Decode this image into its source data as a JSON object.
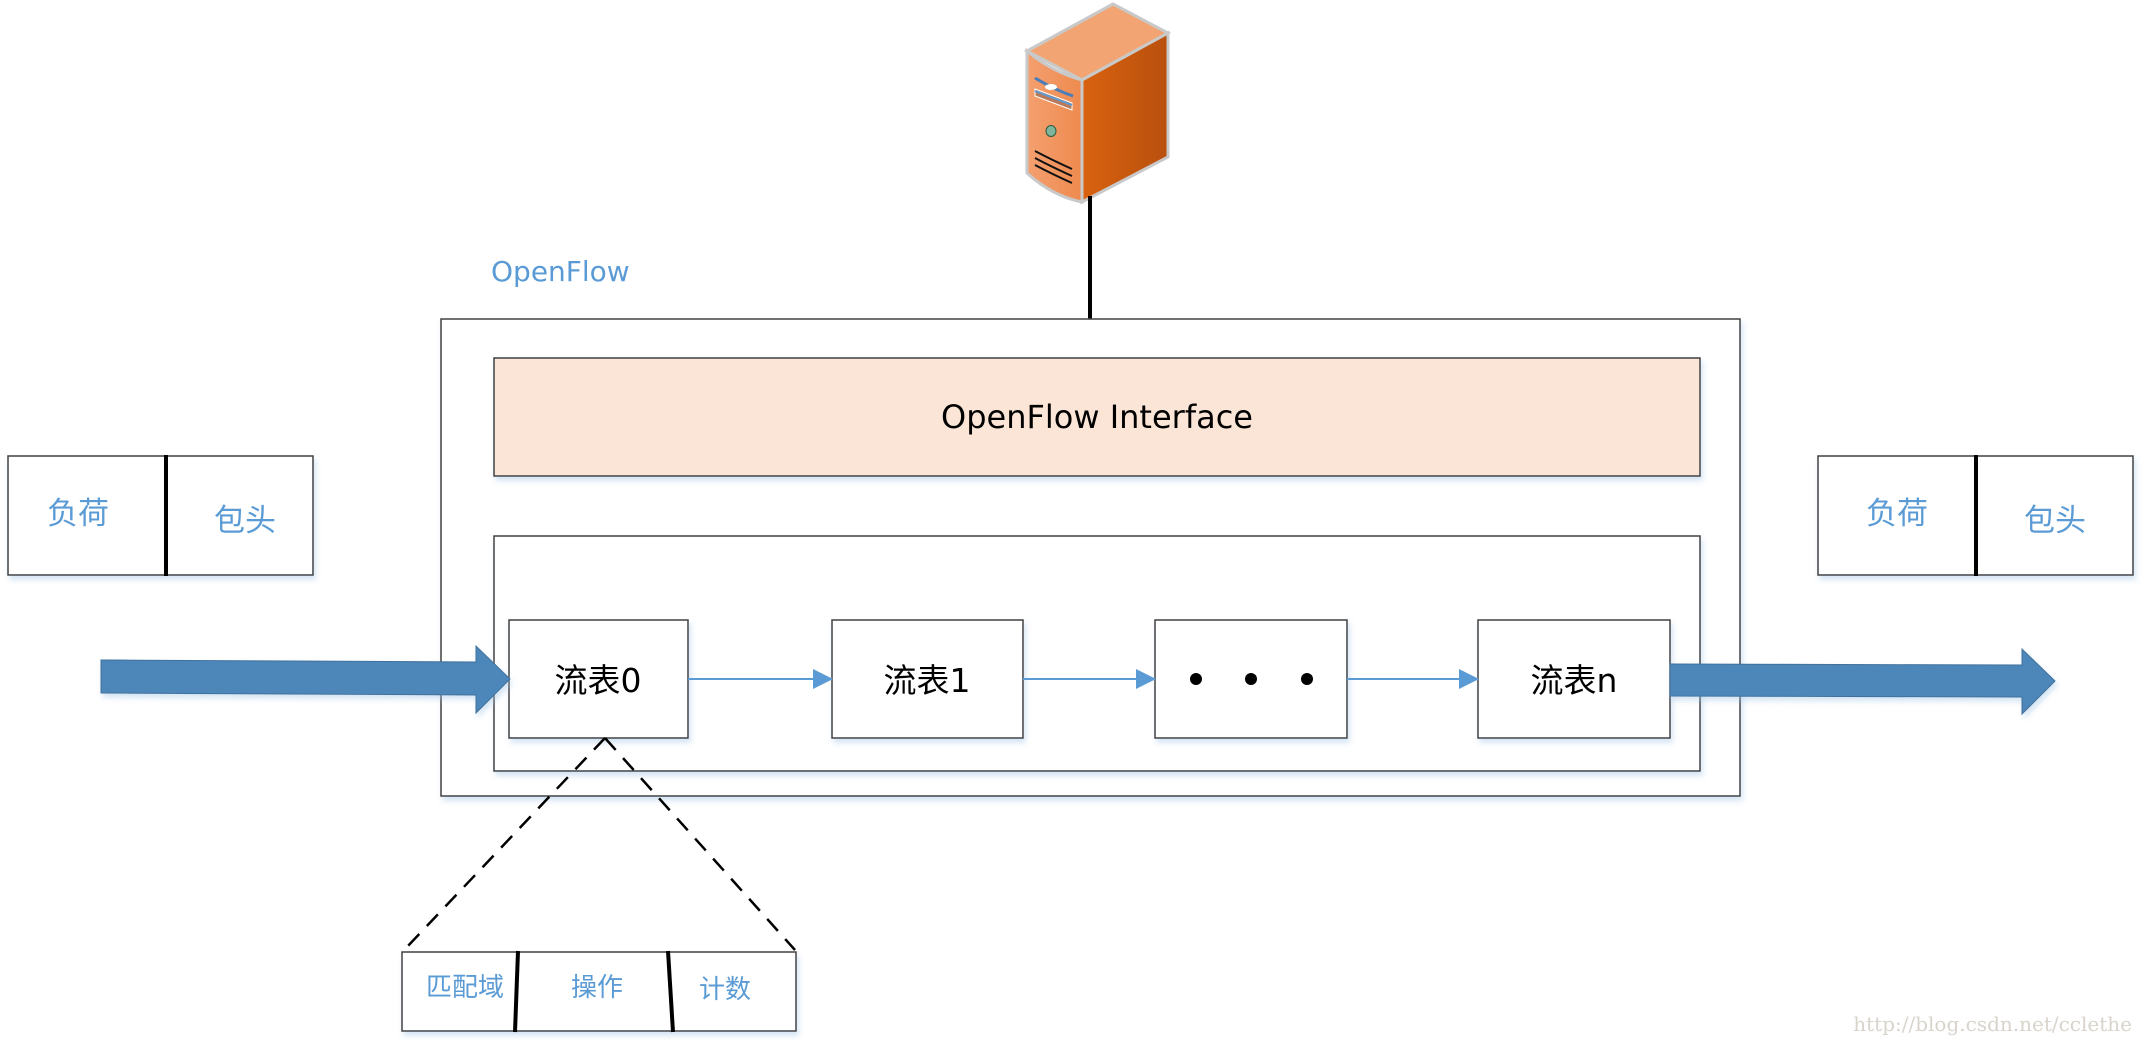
{
  "diagram": {
    "title_label": "OpenFlow",
    "interface_label": "OpenFlow Interface",
    "controller": {
      "icon": "server-icon"
    },
    "flow_tables": [
      {
        "label": "流表0"
      },
      {
        "label": "流表1"
      },
      {
        "label": "• • •"
      },
      {
        "label": "流表n"
      }
    ],
    "packet_in": {
      "payload_label": "负荷",
      "header_label": "包头"
    },
    "packet_out": {
      "payload_label": "负荷",
      "header_label": "包头"
    },
    "flow_entry": {
      "fields": [
        {
          "label": "匹配域"
        },
        {
          "label": "操作"
        },
        {
          "label": "计数"
        }
      ]
    },
    "watermark": "http://blog.csdn.net/cclethe"
  },
  "colors": {
    "accent_blue": "#5B9BD5",
    "arrow_blue": "#4D86B9",
    "interface_fill": "#FBE5D6",
    "server_orange": "#E46C0A"
  }
}
